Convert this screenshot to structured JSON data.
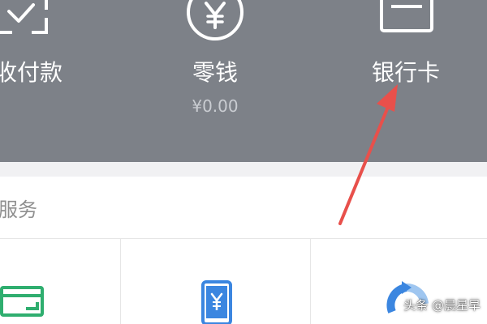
{
  "wallet_header": {
    "items": [
      {
        "label": "收付款",
        "icon": "scan-check-icon"
      },
      {
        "label": "零钱",
        "sub": "¥0.00",
        "icon": "yuan-coin-icon"
      },
      {
        "label": "银行卡",
        "icon": "bank-card-icon"
      }
    ]
  },
  "services": {
    "title": "服务",
    "items": [
      {
        "icon": "credit-card-repay-icon"
      },
      {
        "icon": "phone-recharge-icon"
      },
      {
        "icon": "refresh-circle-icon"
      }
    ]
  },
  "annotation": {
    "icon": "red-arrow-icon"
  },
  "watermark": {
    "text": "头条 @晨星早"
  },
  "colors": {
    "header_bg": "#7d8188",
    "arrow": "#e8504b",
    "green": "#2fae6f",
    "blue": "#3b86e0"
  }
}
